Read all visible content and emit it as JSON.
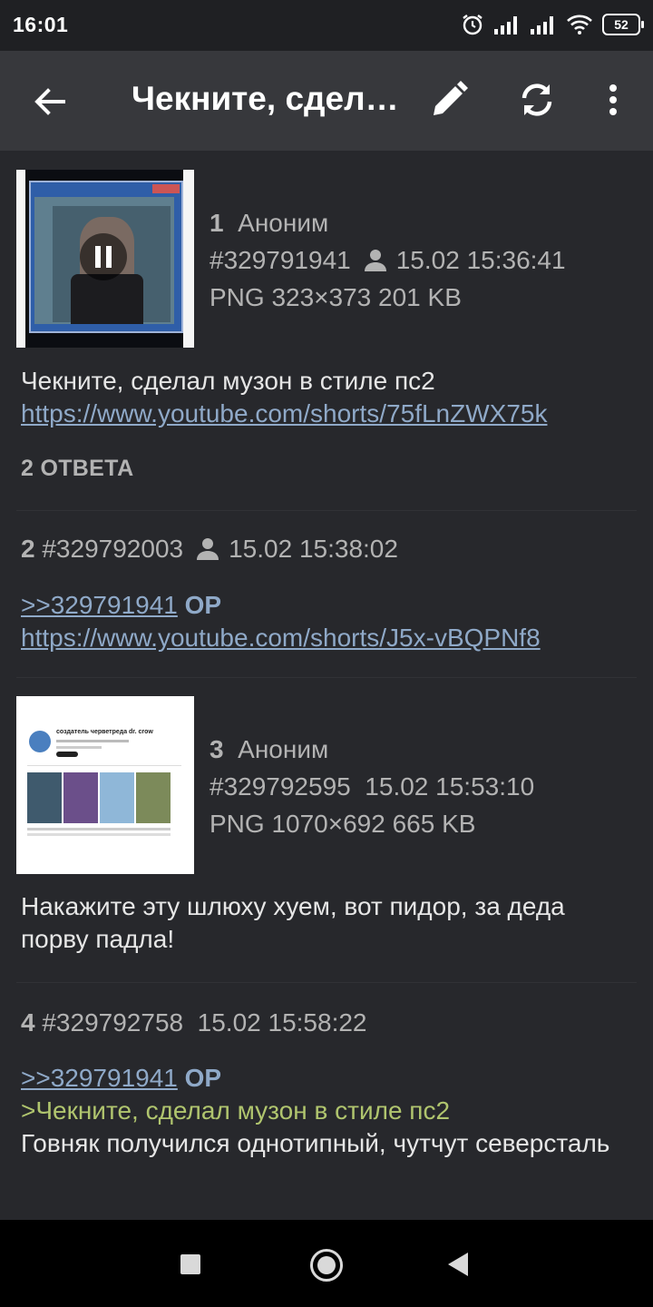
{
  "status_bar": {
    "time": "16:01",
    "battery": "52"
  },
  "toolbar": {
    "title": "Чекните, сдел…"
  },
  "posts": [
    {
      "num": "1",
      "author": "Аноним",
      "id": "#329791941",
      "date": "15.02 15:36:41",
      "file": "PNG 323×373 201 KB",
      "text": "Чекните, сделал музон в стиле пс2",
      "link": "https://www.youtube.com/shorts/75fLnZWX75k",
      "answers": "2 ОТВЕТА"
    },
    {
      "num": "2",
      "id": "#329792003",
      "date": "15.02 15:38:02",
      "reply_ref": ">>329791941",
      "op": "OP",
      "link": "https://www.youtube.com/shorts/J5x-vBQPNf8"
    },
    {
      "num": "3",
      "author": "Аноним",
      "id": "#329792595",
      "date": "15.02 15:53:10",
      "file": "PNG 1070×692 665 KB",
      "text": "Накажите эту шлюху хуем, вот пидор, за деда порву падла!",
      "thumb_title": "создатель черветреда dr. crow"
    },
    {
      "num": "4",
      "id": "#329792758",
      "date": "15.02 15:58:22",
      "reply_ref": ">>329791941",
      "op": "OP",
      "quote": ">Чекните, сделал музон в стиле пс2",
      "text": "Говняк получился однотипный, чутчут северсталь"
    }
  ]
}
